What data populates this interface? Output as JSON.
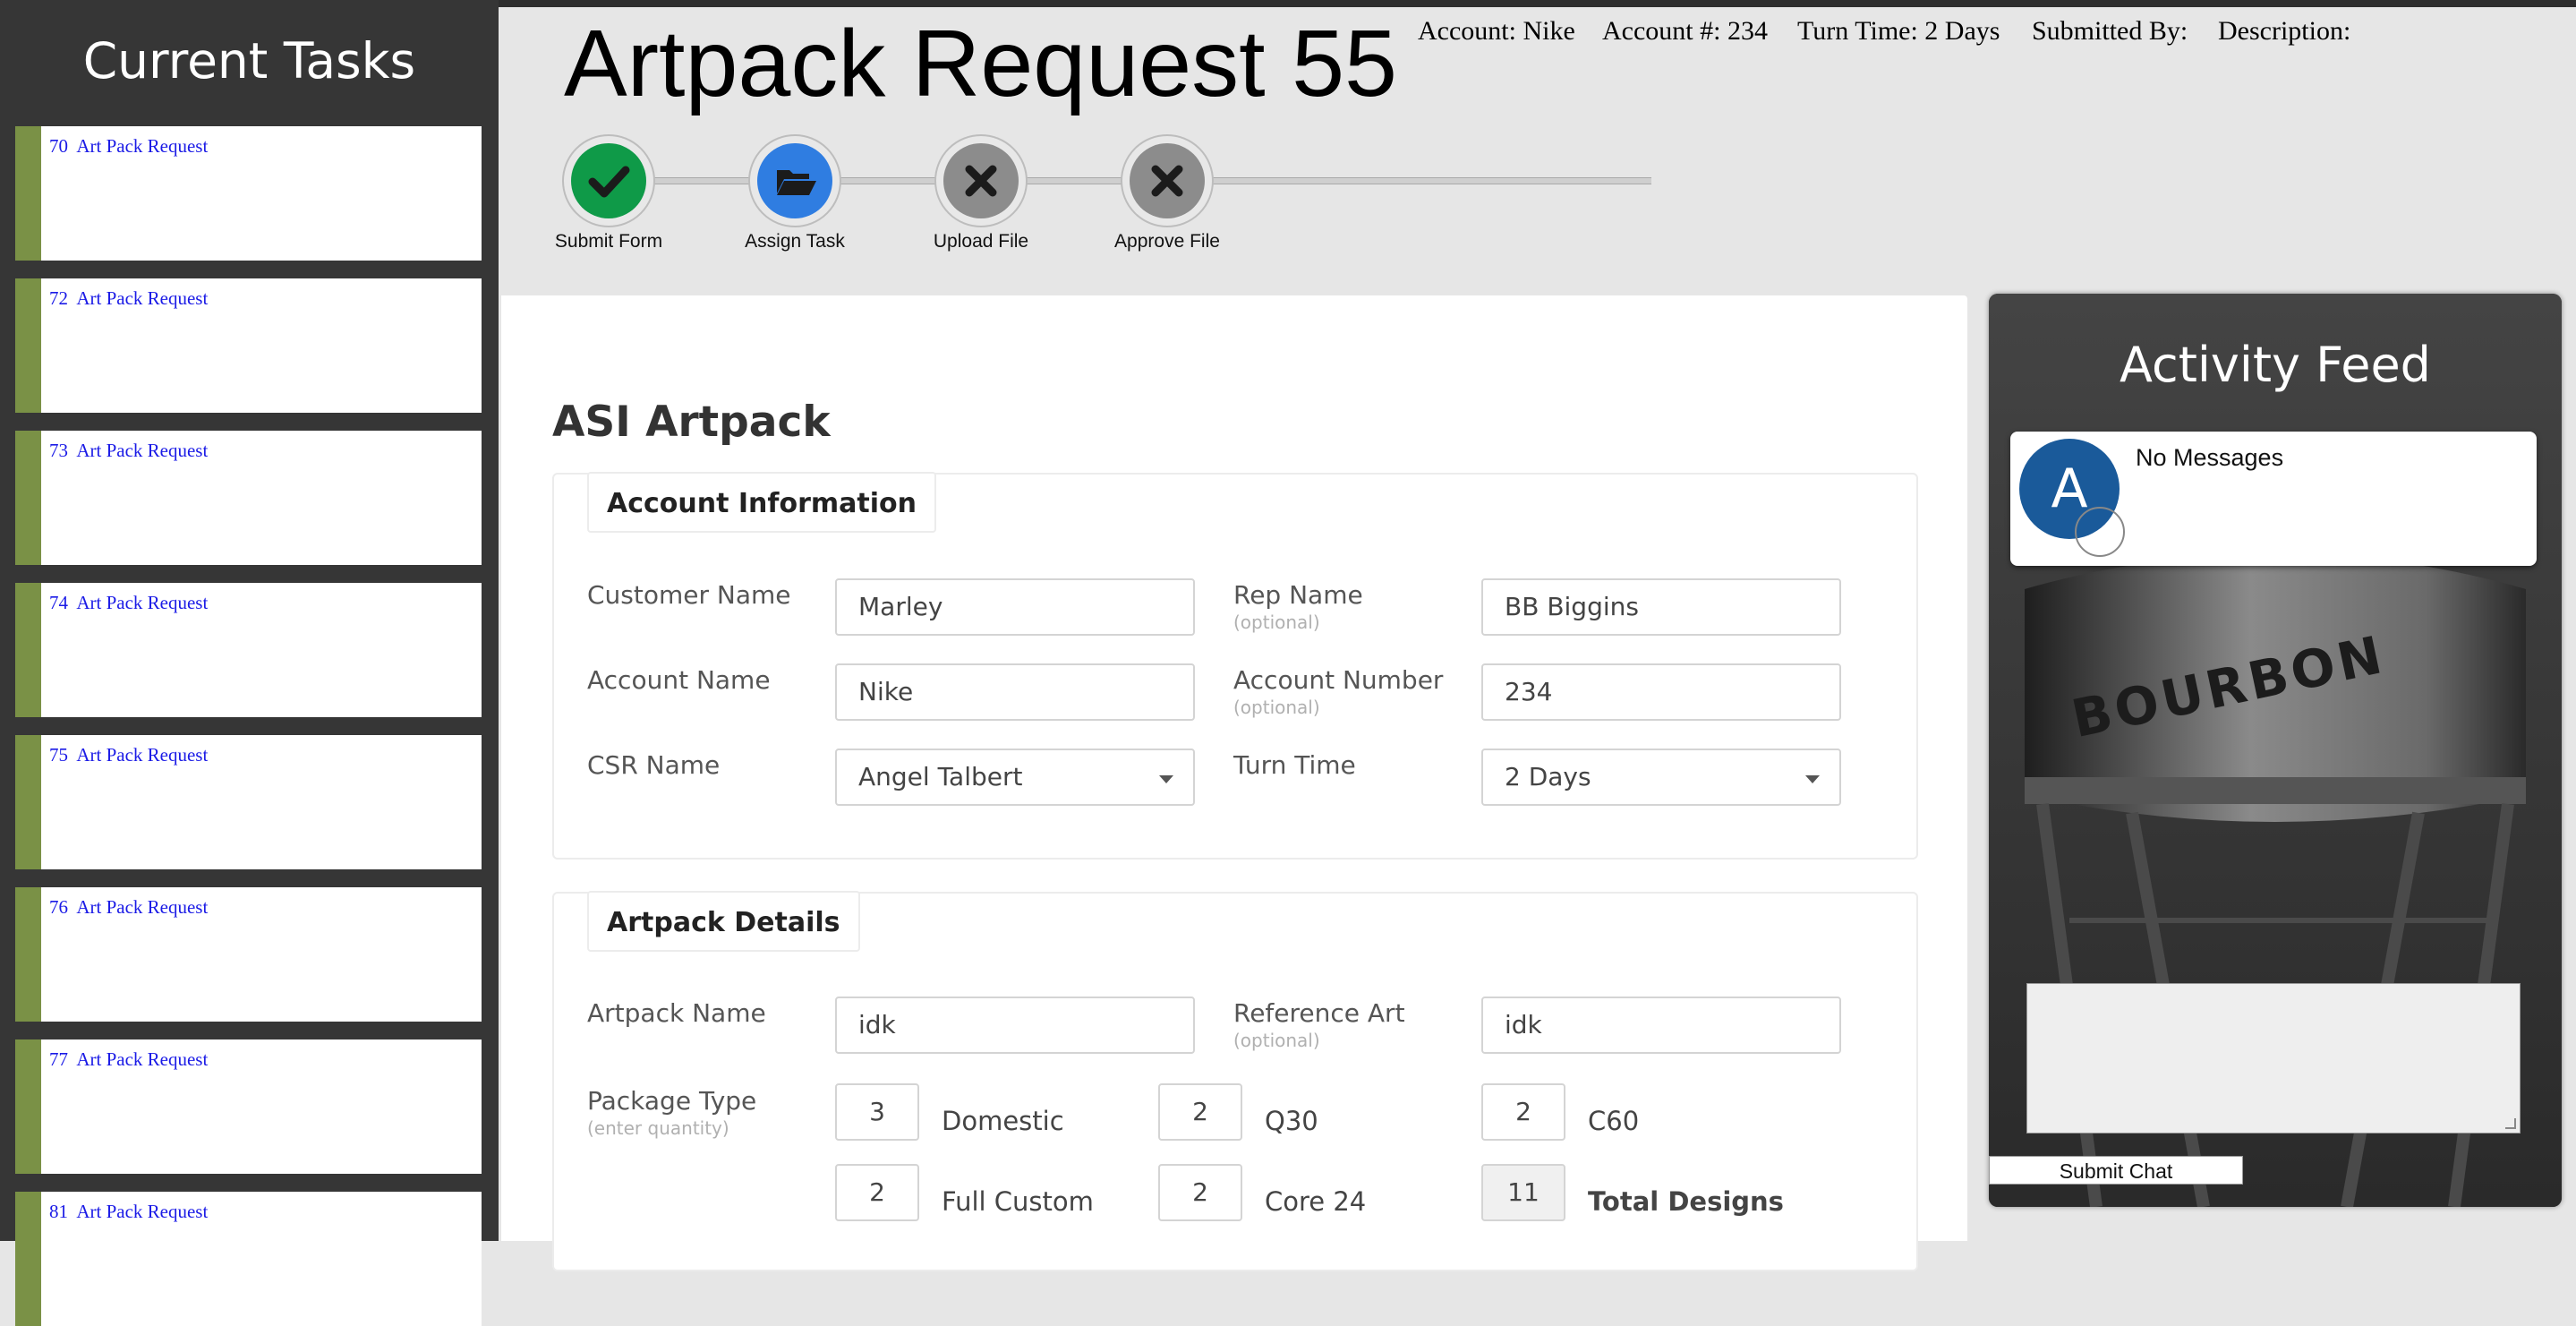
{
  "sidebar": {
    "title": "Current Tasks",
    "tasks": [
      {
        "label": "70  Art Pack Request"
      },
      {
        "label": "72  Art Pack Request"
      },
      {
        "label": "73  Art Pack Request"
      },
      {
        "label": "74  Art Pack Request"
      },
      {
        "label": "75  Art Pack Request"
      },
      {
        "label": "76  Art Pack Request"
      },
      {
        "label": "77  Art Pack Request"
      },
      {
        "label": "81  Art Pack Request"
      }
    ],
    "accent_color": "#7a9146"
  },
  "header": {
    "title": "Artpack Request 55",
    "account": "Account: Nike",
    "account_number": "Account #: 234",
    "turn_time": "Turn Time: 2 Days",
    "submitted_by": "Submitted By:",
    "description": "Description:"
  },
  "steps": [
    {
      "label": "Submit Form",
      "status": "complete",
      "icon": "check-icon",
      "color": "#0f9a48"
    },
    {
      "label": "Assign Task",
      "status": "active",
      "icon": "folder-open-icon",
      "color": "#2f7de1"
    },
    {
      "label": "Upload File",
      "status": "pending",
      "icon": "x-icon",
      "color": "#8c8c8c"
    },
    {
      "label": "Approve File",
      "status": "pending",
      "icon": "x-icon",
      "color": "#8c8c8c"
    }
  ],
  "form": {
    "title": "ASI Artpack",
    "account_section": {
      "legend": "Account Information",
      "customer_name_label": "Customer Name",
      "customer_name": "Marley",
      "rep_name_label": "Rep Name",
      "rep_name_hint": "(optional)",
      "rep_name": "BB Biggins",
      "account_name_label": "Account Name",
      "account_name": "Nike",
      "account_number_label": "Account Number",
      "account_number_hint": "(optional)",
      "account_number": "234",
      "csr_name_label": "CSR Name",
      "csr_name": "Angel Talbert",
      "turn_time_label": "Turn Time",
      "turn_time": "2 Days"
    },
    "details_section": {
      "legend": "Artpack Details",
      "artpack_name_label": "Artpack Name",
      "artpack_name": "idk",
      "reference_art_label": "Reference Art",
      "reference_art_hint": "(optional)",
      "reference_art": "idk",
      "package_type_label": "Package Type",
      "package_type_hint": "(enter quantity)",
      "domestic_qty": "3",
      "domestic_label": "Domestic",
      "q30_qty": "2",
      "q30_label": "Q30",
      "c60_qty": "2",
      "c60_label": "C60",
      "full_custom_qty": "2",
      "full_custom_label": "Full Custom",
      "core24_qty": "2",
      "core24_label": "Core 24",
      "total_qty": "11",
      "total_label": "Total Designs"
    }
  },
  "feed": {
    "title": "Activity Feed",
    "avatar_initial": "A",
    "avatar_color": "#1a5a9a",
    "message": "No Messages",
    "submit_label": "Submit Chat",
    "photo_text": "BOURBON"
  }
}
